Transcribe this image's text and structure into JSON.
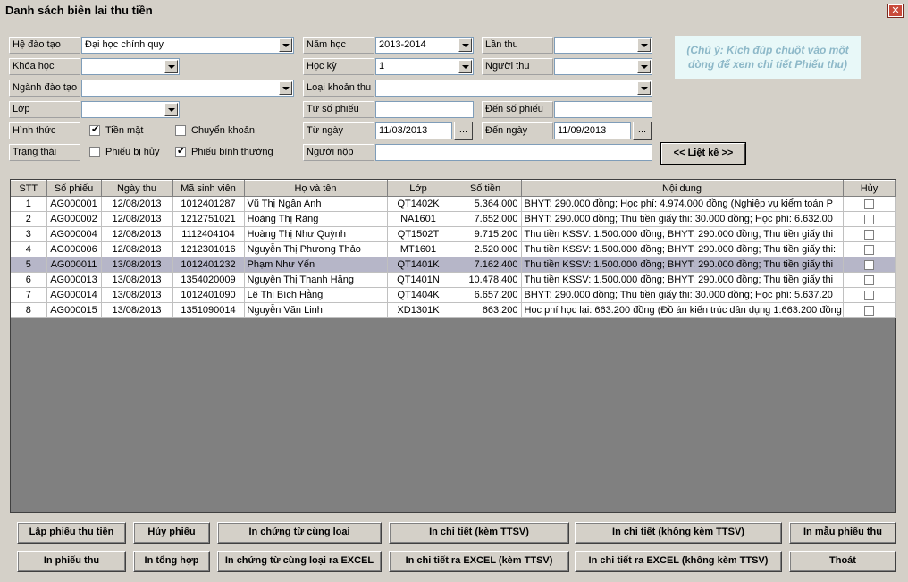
{
  "window": {
    "title": "Danh sách biên lai thu tiền",
    "close": "✕"
  },
  "filters": {
    "he_dao_tao": {
      "label": "Hệ đào tạo",
      "value": "Đại học chính quy"
    },
    "khoa_hoc": {
      "label": "Khóa học",
      "value": ""
    },
    "nganh_dao_tao": {
      "label": "Ngành đào tạo",
      "value": ""
    },
    "lop": {
      "label": "Lớp",
      "value": ""
    },
    "hinh_thuc": {
      "label": "Hình thức",
      "tien_mat": "Tiền mặt",
      "tien_mat_checked": true,
      "chuyen_khoan": "Chuyển khoản",
      "chuyen_khoan_checked": false
    },
    "trang_thai": {
      "label": "Trạng thái",
      "bi_huy": "Phiếu bị hủy",
      "bi_huy_checked": false,
      "binh_thuong": "Phiếu bình thường",
      "binh_thuong_checked": true
    },
    "nam_hoc": {
      "label": "Năm học",
      "value": "2013-2014"
    },
    "hoc_ky": {
      "label": "Học kỳ",
      "value": "1"
    },
    "loai_khoan_thu": {
      "label": "Loại khoản thu",
      "value": ""
    },
    "tu_so_phieu": {
      "label": "Từ số phiếu",
      "value": ""
    },
    "tu_ngay": {
      "label": "Từ ngày",
      "value": "11/03/2013",
      "btn": "..."
    },
    "nguoi_nop": {
      "label": "Người nộp",
      "value": ""
    },
    "lan_thu": {
      "label": "Lần thu",
      "value": ""
    },
    "nguoi_thu": {
      "label": "Người thu",
      "value": ""
    },
    "den_so_phieu": {
      "label": "Đến số phiếu",
      "value": ""
    },
    "den_ngay": {
      "label": "Đến ngày",
      "value": "11/09/2013",
      "btn": "..."
    }
  },
  "note": "(Chú ý: Kích đúp chuột vào một dòng để xem chi tiết Phiếu thu)",
  "list_button": "<< Liệt kê >>",
  "table": {
    "columns": [
      "STT",
      "Số phiếu",
      "Ngày thu",
      "Mã sinh viên",
      "Họ và tên",
      "Lớp",
      "Số tiền",
      "Nội dung",
      "Hủy"
    ],
    "rows": [
      [
        "1",
        "AG000001",
        "12/08/2013",
        "1012401287",
        "Vũ Thị Ngân Anh",
        "QT1402K",
        "5.364.000",
        "BHYT: 290.000 đồng; Học phí: 4.974.000 đồng (Nghiệp vụ kiểm toán P"
      ],
      [
        "2",
        "AG000002",
        "12/08/2013",
        "1212751021",
        "Hoàng Thị Ràng",
        "NA1601",
        "7.652.000",
        "BHYT: 290.000 đồng; Thu tiền giấy thi: 30.000 đồng; Học phí: 6.632.00"
      ],
      [
        "3",
        "AG000004",
        "12/08/2013",
        "1112404104",
        "Hoàng Thị Như Quỳnh",
        "QT1502T",
        "9.715.200",
        "Thu tiền KSSV: 1.500.000 đồng; BHYT: 290.000 đồng; Thu tiền giấy thi"
      ],
      [
        "4",
        "AG000006",
        "12/08/2013",
        "1212301016",
        "Nguyễn Thị Phương Thảo",
        "MT1601",
        "2.520.000",
        "Thu tiền KSSV: 1.500.000 đồng; BHYT: 290.000 đồng; Thu tiền giấy thi:"
      ],
      [
        "5",
        "AG000011",
        "13/08/2013",
        "1012401232",
        "Phạm Như Yến",
        "QT1401K",
        "7.162.400",
        "Thu tiền KSSV: 1.500.000 đồng; BHYT: 290.000 đồng; Thu tiền giấy thi"
      ],
      [
        "6",
        "AG000013",
        "13/08/2013",
        "1354020009",
        "Nguyễn Thị Thanh Hằng",
        "QT1401N",
        "10.478.400",
        "Thu tiền KSSV: 1.500.000 đồng; BHYT: 290.000 đồng; Thu tiền giấy thi"
      ],
      [
        "7",
        "AG000014",
        "13/08/2013",
        "1012401090",
        "Lê Thị Bích Hằng",
        "QT1404K",
        "6.657.200",
        "BHYT: 290.000 đồng; Thu tiền giấy thi: 30.000 đồng; Học phí: 5.637.20"
      ],
      [
        "8",
        "AG000015",
        "13/08/2013",
        "1351090014",
        "Nguyễn Văn Linh",
        "XD1301K",
        "663.200",
        "Học phí học lại: 663.200 đồng (Đồ án kiến trúc dân dụng 1:663.200 đồng"
      ]
    ],
    "selected_row": 4
  },
  "buttons": {
    "lap_phieu": "Lập phiếu thu tiền",
    "huy_phieu": "Hủy phiếu",
    "in_chung_tu": "In chứng từ cùng loại",
    "in_chi_tiet_kem": "In chi tiết (kèm TTSV)",
    "in_chi_tiet_khong": "In chi tiết (không kèm TTSV)",
    "in_mau": "In mẫu phiếu thu",
    "in_phieu": "In phiếu thu",
    "in_tong_hop": "In tổng hợp",
    "in_chung_tu_excel": "In chứng từ cùng loại ra EXCEL",
    "in_chi_tiet_excel_kem": "In chi tiết ra EXCEL (kèm TTSV)",
    "in_chi_tiet_excel_khong": "In chi tiết ra EXCEL (không kèm TTSV)",
    "thoat": "Thoát"
  }
}
